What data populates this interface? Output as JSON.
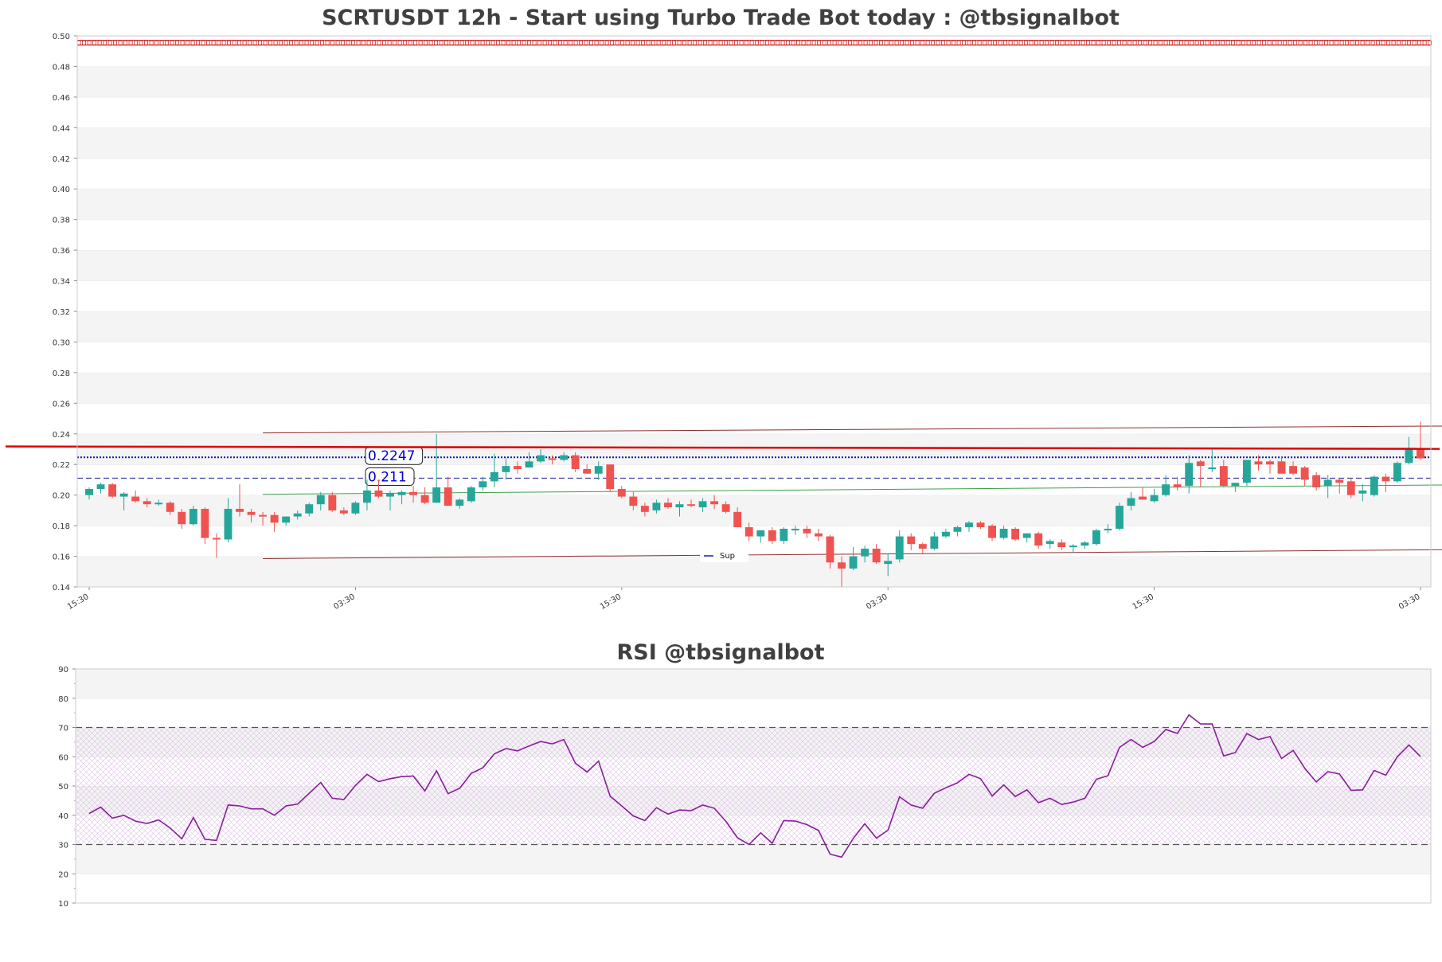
{
  "chart_data": [
    {
      "type": "candlestick",
      "title": "SCRTUSDT 12h - Start using Turbo Trade Bot today : @tbsignalbot",
      "ylim": [
        0.14,
        0.5
      ],
      "yticks": [
        "0.14",
        "0.16",
        "0.18",
        "0.20",
        "0.22",
        "0.24",
        "0.26",
        "0.28",
        "0.30",
        "0.32",
        "0.34",
        "0.36",
        "0.38",
        "0.40",
        "0.42",
        "0.44",
        "0.46",
        "0.48",
        "0.50"
      ],
      "xticks": [
        {
          "label": "15:30",
          "index": 0
        },
        {
          "label": "03:30",
          "index": 23
        },
        {
          "label": "15:30",
          "index": 46
        },
        {
          "label": "03:30",
          "index": 69
        },
        {
          "label": "15:30",
          "index": 92
        },
        {
          "label": "03:30",
          "index": 115
        }
      ],
      "grid": true,
      "up_color": "#26a69a",
      "down_color": "#ef5350",
      "candles": [
        [
          0.2,
          0.205,
          0.197,
          0.204
        ],
        [
          0.204,
          0.208,
          0.201,
          0.207
        ],
        [
          0.207,
          0.208,
          0.198,
          0.199
        ],
        [
          0.199,
          0.202,
          0.19,
          0.201
        ],
        [
          0.199,
          0.203,
          0.195,
          0.196
        ],
        [
          0.196,
          0.198,
          0.192,
          0.194
        ],
        [
          0.194,
          0.197,
          0.193,
          0.195
        ],
        [
          0.195,
          0.196,
          0.187,
          0.189
        ],
        [
          0.189,
          0.191,
          0.178,
          0.181
        ],
        [
          0.181,
          0.193,
          0.18,
          0.191
        ],
        [
          0.191,
          0.192,
          0.168,
          0.172
        ],
        [
          0.172,
          0.175,
          0.159,
          0.171
        ],
        [
          0.171,
          0.198,
          0.169,
          0.191
        ],
        [
          0.191,
          0.207,
          0.186,
          0.189
        ],
        [
          0.189,
          0.191,
          0.182,
          0.187
        ],
        [
          0.187,
          0.189,
          0.18,
          0.186
        ],
        [
          0.187,
          0.189,
          0.176,
          0.182
        ],
        [
          0.182,
          0.186,
          0.18,
          0.186
        ],
        [
          0.186,
          0.19,
          0.184,
          0.188
        ],
        [
          0.188,
          0.195,
          0.186,
          0.194
        ],
        [
          0.194,
          0.202,
          0.19,
          0.2
        ],
        [
          0.2,
          0.202,
          0.189,
          0.19
        ],
        [
          0.19,
          0.192,
          0.187,
          0.188
        ],
        [
          0.188,
          0.196,
          0.187,
          0.195
        ],
        [
          0.195,
          0.21,
          0.19,
          0.203
        ],
        [
          0.203,
          0.21,
          0.198,
          0.199
        ],
        [
          0.199,
          0.203,
          0.19,
          0.201
        ],
        [
          0.2,
          0.203,
          0.194,
          0.202
        ],
        [
          0.202,
          0.206,
          0.195,
          0.2
        ],
        [
          0.2,
          0.205,
          0.194,
          0.195
        ],
        [
          0.195,
          0.24,
          0.195,
          0.205
        ],
        [
          0.205,
          0.212,
          0.193,
          0.193
        ],
        [
          0.193,
          0.198,
          0.191,
          0.197
        ],
        [
          0.196,
          0.206,
          0.195,
          0.205
        ],
        [
          0.205,
          0.212,
          0.203,
          0.209
        ],
        [
          0.209,
          0.227,
          0.205,
          0.215
        ],
        [
          0.215,
          0.224,
          0.21,
          0.219
        ],
        [
          0.219,
          0.222,
          0.214,
          0.217
        ],
        [
          0.218,
          0.228,
          0.218,
          0.222
        ],
        [
          0.222,
          0.23,
          0.221,
          0.226
        ],
        [
          0.224,
          0.226,
          0.22,
          0.223
        ],
        [
          0.223,
          0.228,
          0.222,
          0.226
        ],
        [
          0.226,
          0.228,
          0.215,
          0.217
        ],
        [
          0.217,
          0.22,
          0.214,
          0.214
        ],
        [
          0.214,
          0.222,
          0.21,
          0.219
        ],
        [
          0.22,
          0.22,
          0.202,
          0.204
        ],
        [
          0.204,
          0.206,
          0.198,
          0.199
        ],
        [
          0.199,
          0.202,
          0.19,
          0.193
        ],
        [
          0.193,
          0.195,
          0.186,
          0.189
        ],
        [
          0.19,
          0.197,
          0.188,
          0.195
        ],
        [
          0.195,
          0.198,
          0.191,
          0.192
        ],
        [
          0.192,
          0.196,
          0.186,
          0.194
        ],
        [
          0.194,
          0.197,
          0.192,
          0.193
        ],
        [
          0.192,
          0.198,
          0.189,
          0.196
        ],
        [
          0.196,
          0.2,
          0.191,
          0.194
        ],
        [
          0.194,
          0.196,
          0.188,
          0.189
        ],
        [
          0.189,
          0.192,
          0.18,
          0.179
        ],
        [
          0.179,
          0.182,
          0.17,
          0.173
        ],
        [
          0.173,
          0.177,
          0.169,
          0.177
        ],
        [
          0.177,
          0.179,
          0.168,
          0.17
        ],
        [
          0.17,
          0.179,
          0.168,
          0.178
        ],
        [
          0.177,
          0.18,
          0.174,
          0.178
        ],
        [
          0.178,
          0.18,
          0.172,
          0.175
        ],
        [
          0.175,
          0.178,
          0.17,
          0.173
        ],
        [
          0.173,
          0.174,
          0.152,
          0.156
        ],
        [
          0.156,
          0.16,
          0.14,
          0.152
        ],
        [
          0.152,
          0.166,
          0.151,
          0.16
        ],
        [
          0.16,
          0.167,
          0.156,
          0.165
        ],
        [
          0.165,
          0.168,
          0.155,
          0.156
        ],
        [
          0.155,
          0.162,
          0.147,
          0.157
        ],
        [
          0.158,
          0.177,
          0.156,
          0.173
        ],
        [
          0.173,
          0.175,
          0.164,
          0.168
        ],
        [
          0.168,
          0.169,
          0.162,
          0.165
        ],
        [
          0.165,
          0.176,
          0.164,
          0.173
        ],
        [
          0.173,
          0.178,
          0.172,
          0.176
        ],
        [
          0.176,
          0.18,
          0.173,
          0.179
        ],
        [
          0.179,
          0.183,
          0.176,
          0.182
        ],
        [
          0.182,
          0.183,
          0.178,
          0.179
        ],
        [
          0.18,
          0.181,
          0.17,
          0.172
        ],
        [
          0.172,
          0.18,
          0.171,
          0.178
        ],
        [
          0.178,
          0.179,
          0.17,
          0.171
        ],
        [
          0.172,
          0.175,
          0.169,
          0.175
        ],
        [
          0.175,
          0.176,
          0.165,
          0.167
        ],
        [
          0.168,
          0.171,
          0.165,
          0.17
        ],
        [
          0.169,
          0.171,
          0.164,
          0.166
        ],
        [
          0.166,
          0.168,
          0.162,
          0.167
        ],
        [
          0.167,
          0.17,
          0.165,
          0.169
        ],
        [
          0.168,
          0.178,
          0.167,
          0.177
        ],
        [
          0.177,
          0.181,
          0.175,
          0.178
        ],
        [
          0.178,
          0.195,
          0.177,
          0.193
        ],
        [
          0.193,
          0.202,
          0.19,
          0.198
        ],
        [
          0.199,
          0.205,
          0.197,
          0.197
        ],
        [
          0.196,
          0.204,
          0.195,
          0.2
        ],
        [
          0.2,
          0.213,
          0.199,
          0.207
        ],
        [
          0.207,
          0.212,
          0.203,
          0.205
        ],
        [
          0.206,
          0.226,
          0.201,
          0.221
        ],
        [
          0.222,
          0.223,
          0.205,
          0.219
        ],
        [
          0.218,
          0.23,
          0.215,
          0.218
        ],
        [
          0.219,
          0.223,
          0.205,
          0.206
        ],
        [
          0.206,
          0.208,
          0.202,
          0.208
        ],
        [
          0.208,
          0.223,
          0.206,
          0.223
        ],
        [
          0.222,
          0.226,
          0.216,
          0.22
        ],
        [
          0.222,
          0.223,
          0.214,
          0.22
        ],
        [
          0.222,
          0.225,
          0.214,
          0.214
        ],
        [
          0.219,
          0.222,
          0.213,
          0.214
        ],
        [
          0.218,
          0.219,
          0.206,
          0.21
        ],
        [
          0.213,
          0.215,
          0.203,
          0.205
        ],
        [
          0.206,
          0.213,
          0.198,
          0.21
        ],
        [
          0.21,
          0.211,
          0.201,
          0.208
        ],
        [
          0.209,
          0.211,
          0.198,
          0.2
        ],
        [
          0.201,
          0.207,
          0.196,
          0.203
        ],
        [
          0.2,
          0.213,
          0.199,
          0.212
        ],
        [
          0.212,
          0.214,
          0.202,
          0.209
        ],
        [
          0.209,
          0.222,
          0.208,
          0.221
        ],
        [
          0.221,
          0.238,
          0.22,
          0.23
        ],
        [
          0.23,
          0.248,
          0.223,
          0.224
        ]
      ],
      "hlines": [
        {
          "value": 0.2247,
          "color": "#0b1daa",
          "style": "dotted",
          "label": "0.2247"
        },
        {
          "value": 0.211,
          "color": "#3a3aa8",
          "style": "dashed",
          "label": "0.211"
        }
      ],
      "resistance_band": {
        "value": 0.4955,
        "color": "#d01010"
      },
      "current_price_line": {
        "value": 0.2315,
        "color": "#dd0000"
      },
      "channel_lines": [
        {
          "from": [
            15,
            0.2406
          ],
          "to": [
            117,
            0.2451
          ],
          "color": "#8b2e2e"
        },
        {
          "from": [
            15,
            0.1585
          ],
          "to": [
            117,
            0.1643
          ],
          "color": "#8b2e2e"
        },
        {
          "from": [
            15,
            0.2005
          ],
          "to": [
            117,
            0.2066
          ],
          "color": "#3e9e4a"
        }
      ],
      "legend": [
        {
          "label": "Sup",
          "color": "#1a1aa8"
        }
      ]
    },
    {
      "type": "line",
      "title": "RSI @tbsignalbot",
      "ylim": [
        10,
        90
      ],
      "yticks": [
        "10",
        "20",
        "30",
        "40",
        "50",
        "60",
        "70",
        "80",
        "90"
      ],
      "overbought": 70,
      "oversold": 30,
      "line_color": "#8a1c9c",
      "values": [
        40.6,
        42.8,
        39.0,
        40.0,
        38.0,
        37.2,
        38.4,
        35.6,
        32.0,
        39.2,
        31.8,
        31.4,
        43.5,
        43.2,
        42.2,
        42.2,
        40.0,
        43.2,
        43.8,
        47.5,
        51.2,
        45.8,
        45.4,
        50.2,
        54.0,
        51.5,
        52.5,
        53.2,
        53.4,
        48.3,
        55.2,
        47.4,
        49.2,
        54.3,
        56.2,
        61.0,
        62.8,
        62.0,
        63.7,
        65.2,
        64.4,
        65.9,
        57.8,
        54.8,
        58.5,
        46.5,
        43.2,
        39.8,
        38.2,
        42.6,
        40.4,
        41.8,
        41.6,
        43.5,
        42.4,
        37.9,
        32.3,
        30.0,
        34.0,
        30.5,
        38.2,
        38.0,
        36.8,
        34.8,
        26.7,
        25.7,
        32.1,
        37.1,
        32.2,
        34.9,
        46.3,
        43.5,
        42.4,
        47.5,
        49.4,
        51.1,
        54.0,
        52.5,
        46.6,
        50.4,
        46.4,
        48.7,
        44.3,
        45.8,
        43.7,
        44.5,
        45.8,
        52.3,
        53.5,
        63.2,
        65.9,
        63.2,
        65.2,
        69.3,
        68.0,
        74.3,
        71.2,
        71.2,
        60.3,
        61.4,
        67.9,
        65.9,
        66.9,
        59.4,
        62.2,
        56.1,
        51.4,
        54.9,
        54.1,
        48.5,
        48.7,
        55.3,
        53.7,
        60.0,
        64.0,
        60.1
      ]
    }
  ]
}
